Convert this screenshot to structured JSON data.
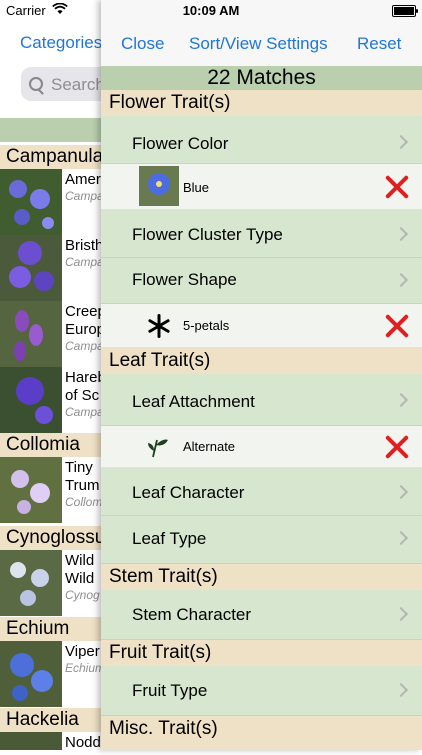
{
  "status": {
    "carrier": "Carrier",
    "time": "10:09 AM"
  },
  "background_list": {
    "categories_label": "Categories",
    "search_placeholder": "Search",
    "sections": [
      {
        "title": "Campanula"
      },
      {
        "title": "Collomia"
      },
      {
        "title": "Cynoglossum"
      },
      {
        "title": "Echium"
      },
      {
        "title": "Hackelia"
      }
    ],
    "rows": [
      {
        "line1": "Amer",
        "line2": "",
        "species": "Campa"
      },
      {
        "line1": "Bristh",
        "line2": "",
        "species": "Campa"
      },
      {
        "line1": "Creep",
        "line2": "Europ",
        "species": "Campa"
      },
      {
        "line1": "Hareb",
        "line2": "of Sc",
        "species": "Campa"
      },
      {
        "line1": "Tiny",
        "line2": "Trum",
        "species": "Collom"
      },
      {
        "line1": "Wild",
        "line2": "Wild",
        "species": "Cynog"
      },
      {
        "line1": "Viper",
        "line2": "",
        "species": "Echium"
      },
      {
        "line1": "Nodd",
        "line2": "",
        "species": ""
      }
    ]
  },
  "sheet": {
    "close": "Close",
    "sort_view": "Sort/View Settings",
    "reset": "Reset",
    "matches": "22 Matches",
    "flower_section": "Flower Trait(s)",
    "flower_color": "Flower Color",
    "blue": "Blue",
    "flower_cluster": "Flower Cluster Type",
    "flower_shape": "Flower Shape",
    "five_petals": "5-petals",
    "leaf_section": "Leaf Trait(s)",
    "leaf_attachment": "Leaf Attachment",
    "alternate": "Alternate",
    "leaf_character": "Leaf Character",
    "leaf_type": "Leaf Type",
    "stem_section": "Stem Trait(s)",
    "stem_character": "Stem Character",
    "fruit_section": "Fruit Trait(s)",
    "fruit_type": "Fruit Type",
    "misc_section": "Misc. Trait(s)"
  }
}
